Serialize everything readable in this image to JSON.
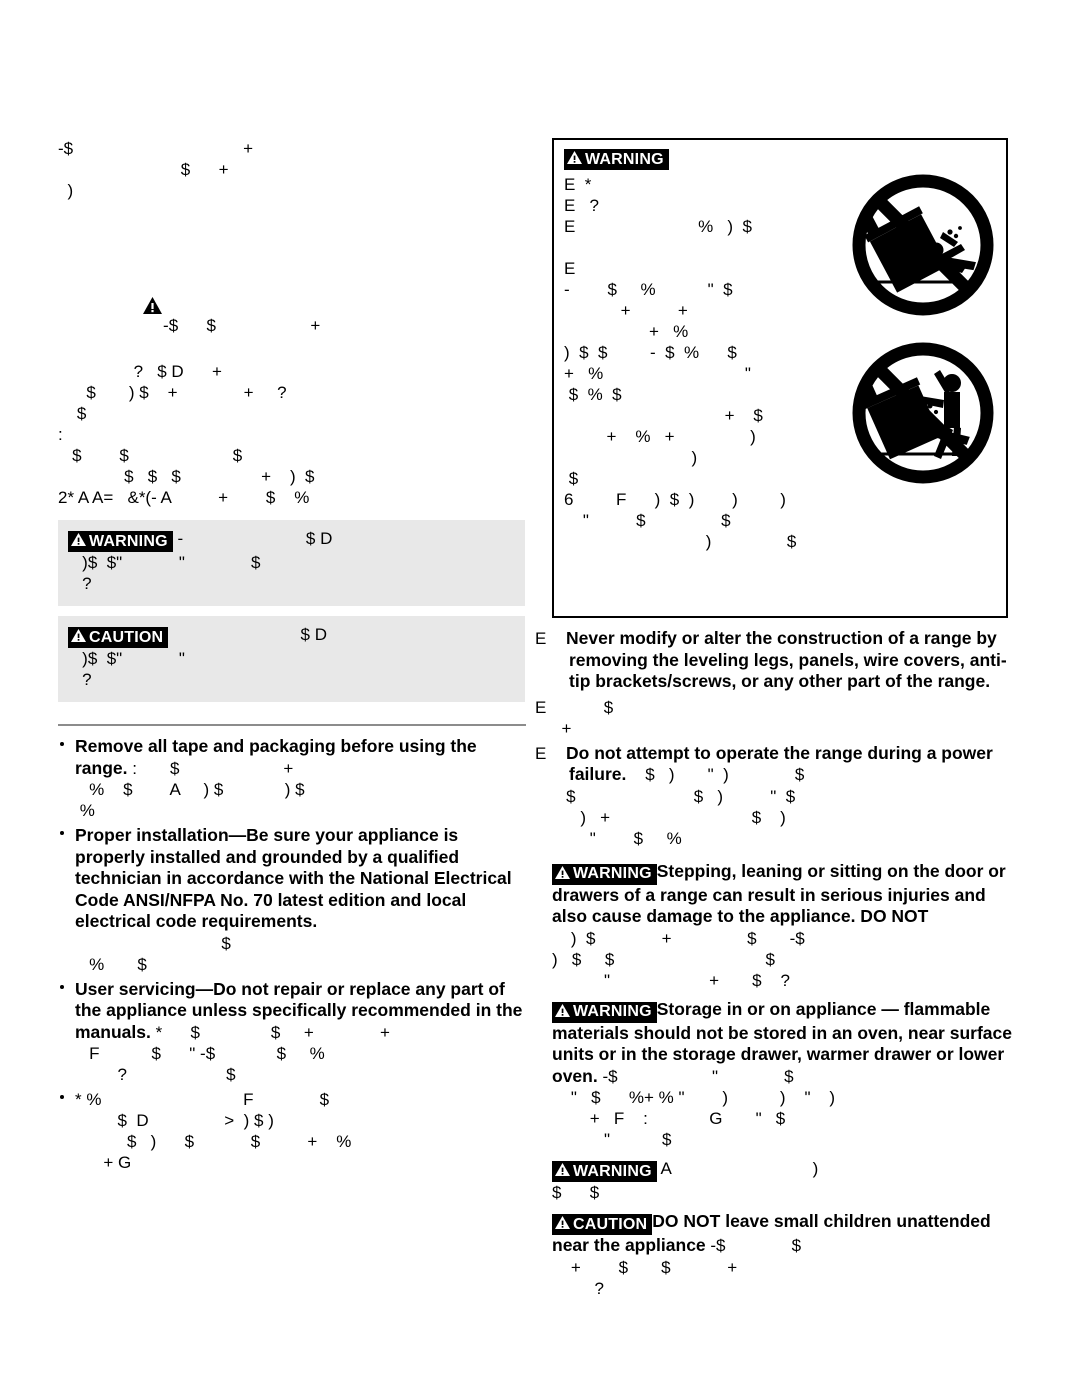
{
  "document": {
    "type": "appliance-safety-manual-page",
    "note_rendering": "scanned page with corrupted font encoding; regular-weight body text renders as substitute symbols, bold text renders legibly"
  },
  "labels": {
    "warning": "WARNING",
    "caution": "CAUTION"
  },
  "colors": {
    "page_background": "#ffffff",
    "text": "#000000",
    "panel_grey": "#e8e8e8",
    "divider_grey": "#8c8c8c",
    "badge_background": "#000000",
    "badge_text": "#ffffff"
  },
  "left_column": {
    "intro_lines": [
      "-$                                    +",
      "                          $      +",
      "  )"
    ],
    "triangle_block": {
      "icon": "warning-triangle-icon",
      "lines": [
        "-$      $                    +",
        "                ?   $ D      +",
        "      $       ) $    +              +     ?",
        "    $",
        ":",
        "   $        $                      $",
        "              $   $   $                 +    )  $",
        "2* A A=   &*(- A          +        $    %"
      ]
    },
    "panels": [
      {
        "badge": "WARNING",
        "lines": [
          " -                          $ D",
          "   )$  $\"            \"              $",
          "   ?"
        ]
      },
      {
        "badge": "CAUTION",
        "lines": [
          "                            $ D",
          "   )$  $\"            \"",
          "   ?"
        ]
      }
    ],
    "bullets": [
      {
        "bold": "Remove all tape and packaging before using the range.",
        "trail": " :       $                      +",
        "lines": [
          "   %    $        A     ) $             ) $",
          " %"
        ]
      },
      {
        "bold": "Proper installation—Be sure your appliance is properly installed and grounded by a qualified technician in accordance with the National Electrical Code ANSI/NFPA No. 70 latest edition and local electrical code requirements.",
        "trail": "",
        "lines": [
          "                               $",
          "   %       $"
        ]
      },
      {
        "bold": "User servicing—Do not repair or replace any part of the appliance unless specifically recommended in the manuals.",
        "trail": " *      $               $     +              +",
        "lines": [
          "   F           $      \" -$             $     %",
          "         ?                     $"
        ]
      },
      {
        "bold": "",
        "trail": "* %                              F              $",
        "lines": [
          "         $  D                >  ) $ )",
          "           $   )      $            $          +    %",
          "      + G"
        ]
      }
    ]
  },
  "right_column": {
    "tip_box": {
      "badge": "WARNING",
      "figures": [
        "no-tipping-range-child-icon",
        "no-standing-on-range-door-icon"
      ],
      "lines": [
        "E  *",
        "E   ?",
        "E                          %   )  $",
        "",
        "E",
        "-        $     %           \"  $",
        "            +          +",
        "                  +   %",
        ")  $  $         -  $  %      $",
        "+   %                              \"",
        " $  %  $",
        "                                  +    $",
        "         +    %   +                )",
        "                           )",
        " $",
        "6         F      )  $  )        )         )",
        "    \"          $                $",
        "                              )                $",
        "                                        +    %"
      ]
    },
    "items": [
      {
        "marker": "E",
        "bold": "Never modify or alter the construction of a range by removing the leveling legs, panels, wire covers, anti-tip brackets/screws, or any other part of the range.",
        "trail": "",
        "lines": []
      },
      {
        "marker": "E",
        "bold": "",
        "trail": "        $",
        "lines": [
          "  +"
        ]
      },
      {
        "marker": "E",
        "bold": "Do not attempt to operate the range during a power failure.",
        "trail": "    $   )       \"  )              $",
        "lines": [
          "   $                         $   )          \"  $",
          "      )   +                              $    )",
          "        \"        $     %"
        ]
      }
    ],
    "notices": [
      {
        "badge": "WARNING",
        "bold": "Stepping, leaning or sitting on the door or drawers of a range can result in serious injuries and also cause damage to the appliance. DO NOT",
        "trail": "",
        "lines": [
          "    )  $              +                $       -$",
          ")   $     $                                $",
          "           \"                     +       $    ?"
        ]
      },
      {
        "badge": "WARNING",
        "bold": "Storage in or on appliance — flammable materials should not be stored in an oven, near surface units or in the storage drawer, warmer drawer or lower oven.",
        "trail": " -$                    \"              $",
        "lines": [
          "    \"   $      %+ % \"        )           )    \"    )",
          "        +   F    :             G       \"   $",
          "           \"           $"
        ]
      },
      {
        "badge": "WARNING",
        "bold": "",
        "trail": " A                              )",
        "lines": [
          "$      $"
        ]
      },
      {
        "badge": "CAUTION",
        "bold": "DO NOT leave small children unattended near the appliance",
        "trail": " -$              $",
        "lines": [
          "    +        $       $            +",
          "         ?"
        ]
      }
    ]
  }
}
